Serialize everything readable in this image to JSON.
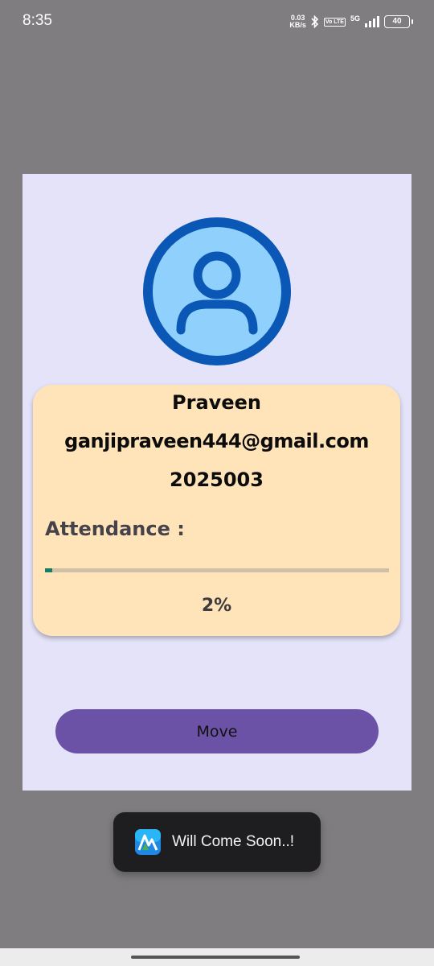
{
  "status_bar": {
    "time": "8:35",
    "net_speed_value": "0.03",
    "net_speed_unit": "KB/s",
    "volte_label": "Vo LTE",
    "network_type": "5G",
    "battery_level": "40"
  },
  "profile": {
    "name": "Praveen",
    "email": "ganjipraveen444@gmail.com",
    "id": "2025003",
    "attendance_label": "Attendance :",
    "attendance_percent_text": "2%",
    "attendance_fraction": 0.02
  },
  "actions": {
    "move_label": "Move"
  },
  "toast": {
    "message": "Will Come Soon..!"
  },
  "colors": {
    "overlay": "#7f7d80",
    "dialog_bg": "#e4e3f9",
    "card_bg": "#ffe3b9",
    "button_bg": "#6b52a6",
    "progress_fill": "#0f7f66",
    "avatar_ring": "#0a57b5",
    "avatar_fill": "#8fd0fc"
  },
  "icons": {
    "avatar": "user-circle-icon",
    "toast_app": "app-logo-icon"
  }
}
